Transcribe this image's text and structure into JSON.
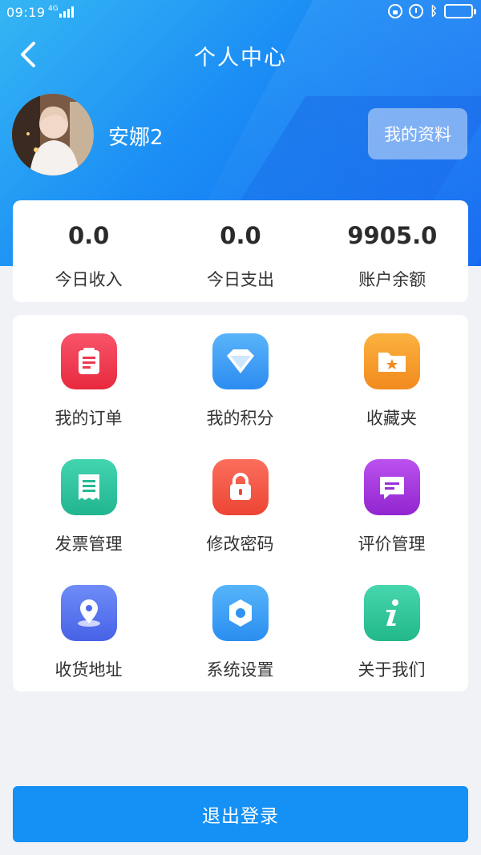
{
  "status_bar": {
    "time": "09:19",
    "network": "4G"
  },
  "header": {
    "title": "个人中心"
  },
  "profile": {
    "username": "安娜2",
    "profile_button": "我的资料"
  },
  "stats": [
    {
      "value": "0.0",
      "label": "今日收入"
    },
    {
      "value": "0.0",
      "label": "今日支出"
    },
    {
      "value": "9905.0",
      "label": "账户余额"
    }
  ],
  "menu": [
    {
      "label": "我的订单",
      "icon": "order-icon",
      "color": "#f0384e"
    },
    {
      "label": "我的积分",
      "icon": "diamond-icon",
      "color": "#3a9bf5"
    },
    {
      "label": "收藏夹",
      "icon": "folder-star-icon",
      "color": "#f79a2a"
    },
    {
      "label": "发票管理",
      "icon": "invoice-icon",
      "color": "#2ec4a0"
    },
    {
      "label": "修改密码",
      "icon": "lock-icon",
      "color": "#f05a4a"
    },
    {
      "label": "评价管理",
      "icon": "comment-icon",
      "color": "#a33ddc"
    },
    {
      "label": "收货地址",
      "icon": "location-icon",
      "color": "#5a78f0"
    },
    {
      "label": "系统设置",
      "icon": "gear-icon",
      "color": "#3aa0f0"
    },
    {
      "label": "关于我们",
      "icon": "info-icon",
      "color": "#2ec49a"
    }
  ],
  "logout_button": "退出登录"
}
